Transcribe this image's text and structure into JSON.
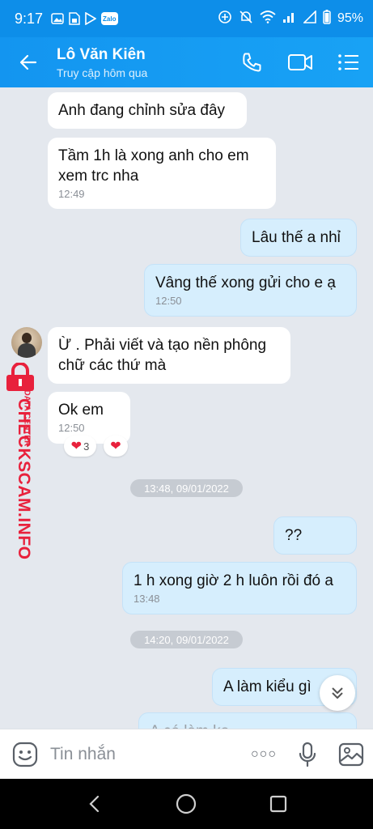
{
  "status": {
    "time": "9:17",
    "left_icons": [
      "image-icon",
      "sim-icon",
      "play-store-icon",
      "zalo-icon"
    ],
    "zalo_mini": "Zalo",
    "battery": "95%"
  },
  "header": {
    "name": "Lô Văn Kiên",
    "subtitle": "Truy cập hôm qua"
  },
  "messages": [
    {
      "dir": "in",
      "text": "Anh đang chỉnh sửa đây",
      "time": ""
    },
    {
      "dir": "in",
      "text": "Tầm 1h là xong anh cho em xem trc nha",
      "time": "12:49"
    },
    {
      "dir": "out",
      "text": "Lâu thế a nhỉ",
      "time": ""
    },
    {
      "dir": "out",
      "text": "Vâng thế xong gửi cho e ạ",
      "time": "12:50"
    },
    {
      "dir": "in",
      "text": "Ừ . Phải viết và tạo nền phông chữ các thứ mà",
      "time": ""
    },
    {
      "dir": "in",
      "text": "Ok em",
      "time": "12:50"
    },
    {
      "dir": "out",
      "text": "??",
      "time": ""
    },
    {
      "dir": "out",
      "text": "1 h xong giờ 2 h luôn rồi đó a",
      "time": "13:48"
    },
    {
      "dir": "out",
      "text": "A làm kiểu gì",
      "time": ""
    },
    {
      "dir": "out",
      "text": "A có làm ko...",
      "time": ""
    }
  ],
  "reactions": {
    "count": "3",
    "heart": "❤"
  },
  "date_separators": [
    "13:48, 09/01/2022",
    "14:20, 09/01/2022"
  ],
  "watermark": {
    "brand": "CHECKSCAM.INFO",
    "sub": "DATA CENTER"
  },
  "composer": {
    "placeholder": "Tin nhắn",
    "more": "○○○"
  },
  "colors": {
    "header": "#1395f0",
    "outgoing": "#d6eefd",
    "background": "#e4e8ee",
    "watermark": "#e8213c"
  }
}
